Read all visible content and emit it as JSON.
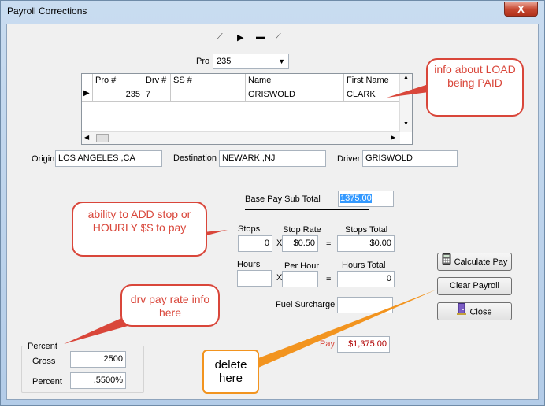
{
  "window": {
    "title": "Payroll Corrections",
    "close_glyph": "X"
  },
  "nav": {
    "first": "⟋",
    "next": "▶",
    "stop": "▬",
    "last": "⟋"
  },
  "pro": {
    "label": "Pro",
    "value": "235"
  },
  "grid": {
    "columns": [
      "Pro #",
      "Drv #",
      "SS #",
      "Name",
      "First Name"
    ],
    "rows": [
      {
        "pro": "235",
        "drv": "7",
        "ss": "",
        "name": "GRISWOLD",
        "first": "CLARK"
      }
    ]
  },
  "origin": {
    "label": "Origin",
    "value": "LOS ANGELES ,CA"
  },
  "destination": {
    "label": "Destination",
    "value": "NEWARK ,NJ"
  },
  "driver": {
    "label": "Driver",
    "value": "GRISWOLD"
  },
  "base_pay": {
    "label": "Base Pay Sub Total",
    "value": "1375.00"
  },
  "stops": {
    "label": "Stops",
    "value": "0",
    "x": "X",
    "rate_label": "Stop Rate",
    "rate_value": "$0.50",
    "eq": "=",
    "total_label": "Stops Total",
    "total_value": "$0.00"
  },
  "hours": {
    "label": "Hours",
    "value": "",
    "x": "X",
    "rate_label": "Per Hour",
    "rate_value": "",
    "eq": "=",
    "total_label": "Hours Total",
    "total_value": "0"
  },
  "fuel": {
    "label": "Fuel Surcharge",
    "value": ""
  },
  "net_pay": {
    "label": "Pay",
    "value": "$1,375.00"
  },
  "buttons": {
    "calculate": "Calculate Pay",
    "clear": "Clear Payroll",
    "close": "Close"
  },
  "percent_group": {
    "label": "Percent",
    "gross_label": "Gross",
    "gross_value": "2500",
    "percent_label": "Percent",
    "percent_value": ".5500%"
  },
  "callouts": {
    "load": "info about LOAD  being PAID",
    "stops": "ability to ADD stop or HOURLY $$ to pay",
    "rate": "drv pay rate info here",
    "delete": "delete here"
  },
  "colors": {
    "callout_red": "#d9463a",
    "callout_orange": "#f2941f",
    "close_red": "#c74a33"
  }
}
